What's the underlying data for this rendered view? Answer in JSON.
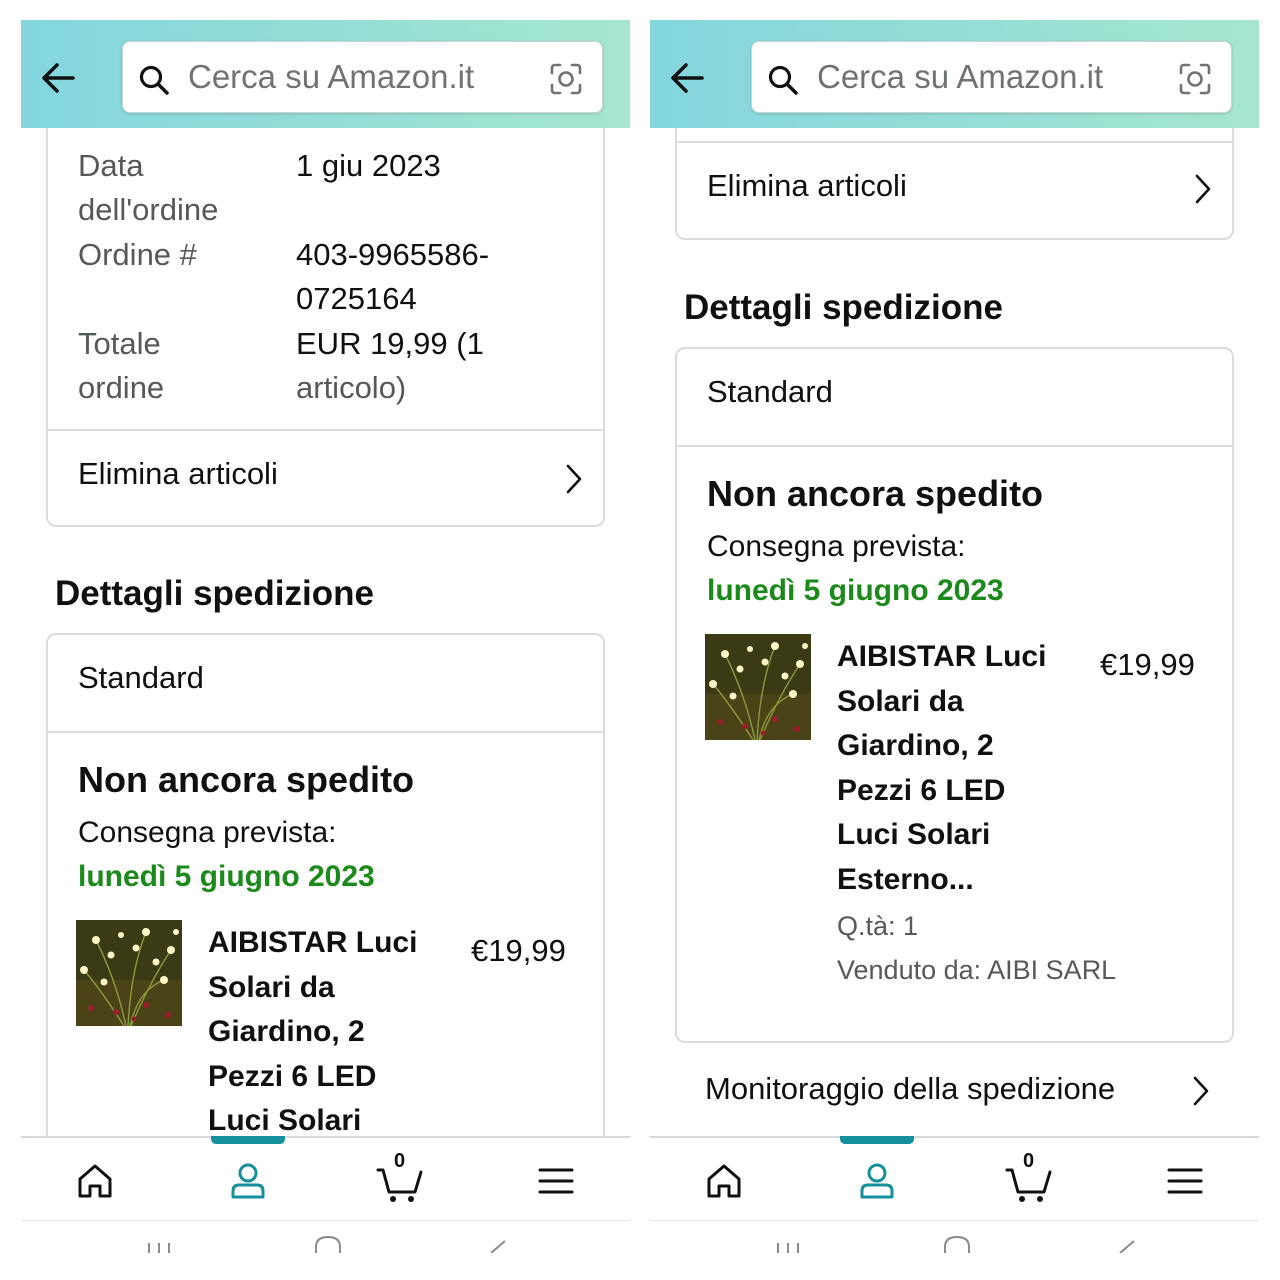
{
  "search": {
    "placeholder": "Cerca su Amazon.it"
  },
  "order": {
    "date_label": "Data dell'ordine",
    "date_label_line1": "Data",
    "date_label_line2": "dell'ordine",
    "date_value": "1 giu 2023",
    "number_label": "Ordine #",
    "number_value_line1": "403-9965586-",
    "number_value_line2": "0725164",
    "total_label_line1": "Totale",
    "total_label_line2": "ordine",
    "total_value_line1": "EUR 19,99 (1",
    "total_value_line2": "articolo)"
  },
  "actions": {
    "delete_items": "Elimina articoli",
    "track_shipment": "Monitoraggio della spedizione"
  },
  "shipping": {
    "section_title": "Dettagli spedizione",
    "method": "Standard",
    "status": "Non ancora spedito",
    "delivery_label": "Consegna prevista:",
    "delivery_date": "lunedì 5 giugno 2023"
  },
  "product": {
    "title_lines": [
      "AIBISTAR Luci",
      "Solari da",
      "Giardino, 2",
      "Pezzi 6 LED",
      "Luci Solari",
      "Esterno..."
    ],
    "price": "€19,99",
    "quantity": "Q.tà: 1",
    "seller": "Venduto da: AIBI SARL"
  },
  "bottom_nav": {
    "items": [
      "home-icon",
      "account-icon",
      "cart-icon",
      "menu-icon"
    ],
    "active": "account-icon",
    "cart_count": "0"
  },
  "colors": {
    "header_gradient_start": "#83d6de",
    "header_gradient_end": "#a6e6cf",
    "delivery_green": "#1a8a1a",
    "nav_active": "#148f9b"
  }
}
